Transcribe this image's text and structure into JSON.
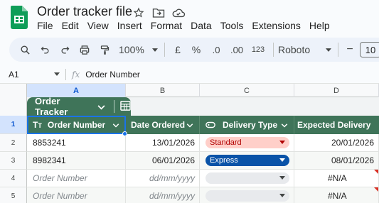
{
  "app": {
    "title": "Order tracker file",
    "menu": [
      "File",
      "Edit",
      "View",
      "Insert",
      "Format",
      "Data",
      "Tools",
      "Extensions",
      "Help"
    ]
  },
  "toolbar": {
    "zoom": "100%",
    "currency": "£",
    "percent": "%",
    "decrease_decimal": ".0",
    "increase_decimal": ".00",
    "number_format": "123",
    "font": "Roboto",
    "font_size": "10",
    "minus": "−"
  },
  "formula_bar": {
    "cell_ref": "A1",
    "fx": "fx",
    "value": "Order Number"
  },
  "columns": [
    "A",
    "B",
    "C",
    "D"
  ],
  "rows": [
    "1",
    "2",
    "3",
    "4",
    "5"
  ],
  "table": {
    "name": "Order Tracker",
    "headers": [
      "Order Number",
      "Date Ordered",
      "Delivery Type",
      "Expected Delivery"
    ],
    "data": [
      {
        "order": "8853241",
        "date": "13/01/2026",
        "delivery": "Standard",
        "expected": "20/01/2026"
      },
      {
        "order": "8982341",
        "date": "06/01/2026",
        "delivery": "Express",
        "expected": "08/01/2026"
      },
      {
        "order": "Order Number",
        "date": "dd/mm/yyyy",
        "delivery": "",
        "expected": "#N/A"
      },
      {
        "order": "Order Number",
        "date": "dd/mm/yyyy",
        "delivery": "",
        "expected": "#N/A"
      }
    ]
  },
  "colors": {
    "table_header": "#3f7459",
    "standard_chip": "#ffcfc9",
    "express_chip": "#0a53a8",
    "empty_chip": "#e8eaed",
    "selection": "#1a73e8"
  }
}
